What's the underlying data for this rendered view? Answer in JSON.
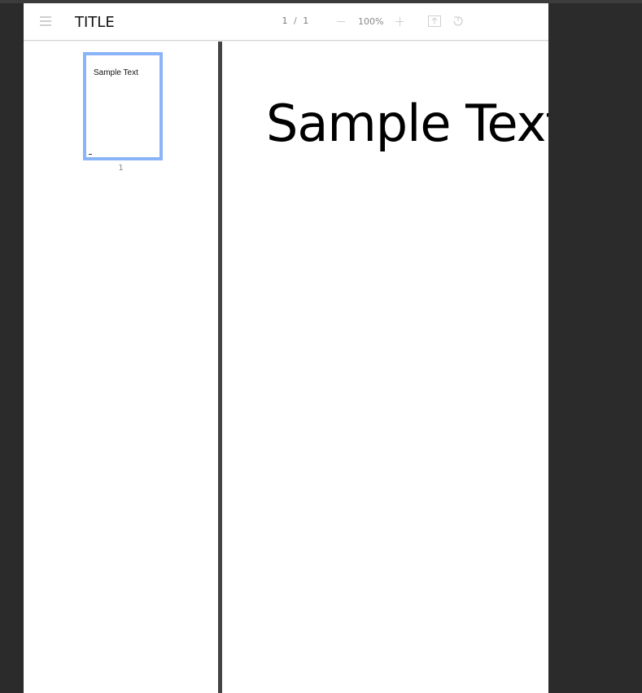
{
  "toolbar": {
    "title": "TITLE",
    "page_current": "1",
    "page_separator": "/",
    "page_total": "1",
    "zoom_level": "100%"
  },
  "icons": {
    "menu": "hamburger-menu-icon",
    "zoom_out": "minus-icon",
    "zoom_in": "plus-icon",
    "fit": "fit-to-page-icon",
    "rotate": "rotate-icon"
  },
  "sidebar": {
    "thumbnails": [
      {
        "text": "Sample Text",
        "page_label": "1"
      }
    ]
  },
  "document": {
    "page_text": "Sample Text"
  },
  "colors": {
    "thumbnail_selected_border": "#8ab4f8",
    "background": "#2b2b2b"
  }
}
